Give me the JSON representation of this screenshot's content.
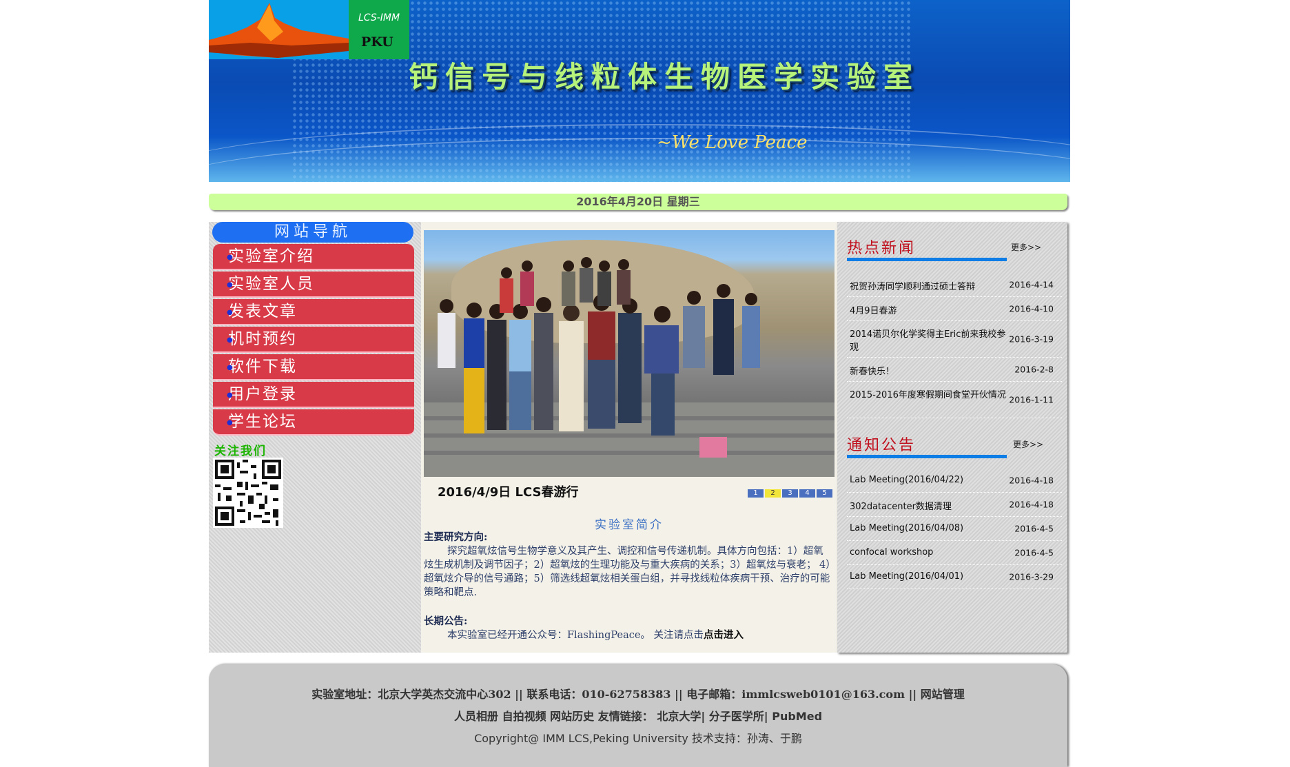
{
  "header": {
    "logo_line1": "LCS-IMM",
    "logo_line2": "PKU",
    "lab_title": "钙信号与线粒体生物医学实验室",
    "slogan": "~We Love Peace"
  },
  "date_bar": "2016年4月20日 星期三",
  "nav": {
    "title": "网站导航",
    "items": [
      {
        "label": "实验室介绍"
      },
      {
        "label": "实验室人员"
      },
      {
        "label": "发表文章"
      },
      {
        "label": "机时预约"
      },
      {
        "label": "软件下载"
      },
      {
        "label": "用户登录"
      },
      {
        "label": "学生论坛"
      }
    ]
  },
  "follow": {
    "title": "关注我们"
  },
  "slideshow": {
    "caption": "2016/4/9日 LCS春游行",
    "pages": [
      "1",
      "2",
      "3",
      "4",
      "5"
    ],
    "active_page": 2
  },
  "intro": {
    "title": "实验室简介",
    "research_heading": "主要研究方向:",
    "research_body": "探究超氧炫信号生物学意义及其产生、调控和信号传递机制。具体方向包括：1）超氧炫生成机制及调节因子；2）超氧炫的生理功能及与重大疾病的关系；3）超氧炫与衰老；  4）超氧炫介导的信号通路；5）筛选线超氧炫相关蛋白组，并寻找线粒体疾病干预、治疗的可能策略和靶点.",
    "notice_heading": "长期公告:",
    "notice_body": "本实验室已经开通公众号：FlashingPeace。 关注请点击",
    "notice_link": "点击进入"
  },
  "hot_news": {
    "title": "热点新闻",
    "more": "更多>>",
    "items": [
      {
        "title": "祝贺孙涛同学顺利通过硕士答辩",
        "date": "2016-4-14"
      },
      {
        "title": "4月9日春游",
        "date": "2016-4-10"
      },
      {
        "title": "2014诺贝尔化学奖得主Eric前来我校参观",
        "date": "2016-3-19"
      },
      {
        "title": "新春快乐！",
        "date": "2016-2-8"
      },
      {
        "title": "2015-2016年度寒假期间食堂开伙情况",
        "date": "2016-1-11"
      }
    ]
  },
  "notices": {
    "title": "通知公告",
    "more": "更多>>",
    "items": [
      {
        "title": "Lab Meeting(2016/04/22)",
        "date": "2016-4-18"
      },
      {
        "title": "302datacenter数据清理",
        "date": "2016-4-18"
      },
      {
        "title": "Lab Meeting(2016/04/08)",
        "date": "2016-4-5"
      },
      {
        "title": "confocal workshop",
        "date": "2016-4-5"
      },
      {
        "title": "Lab Meeting(2016/04/01)",
        "date": "2016-3-29"
      }
    ]
  },
  "footer": {
    "address": "实验室地址：北京大学英杰交流中心302 ||  联系电话：010-62758383 ||   电子邮箱：immlcsweb0101@163.com ||   网站管理",
    "links": {
      "album": "人员相册",
      "video": "自拍视频",
      "history": "网站历史",
      "friends": "友情链接：",
      "pku": "北京大学",
      "sep1": "| ",
      "imm": "分子医学所",
      "sep2": "| ",
      "pubmed": "PubMed"
    },
    "copyright": "Copyright@ IMM LCS,Peking University    技术支持：孙涛、于鹏"
  },
  "colors": {
    "nav_item": "#d83a48",
    "nav_head": "#1e6ff2",
    "date_bar": "#ccff99",
    "section_title": "#c0101e",
    "section_underline": "#0e7de6",
    "title_text": "#b7f37a"
  }
}
